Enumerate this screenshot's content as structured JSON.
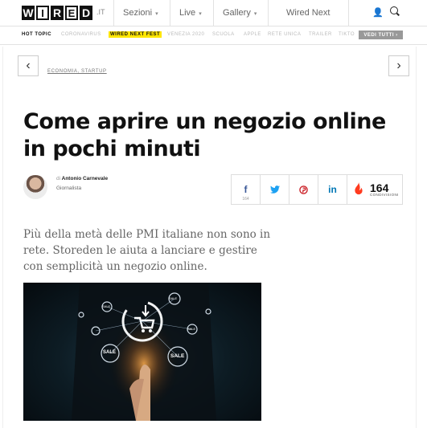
{
  "header": {
    "logo_letters": [
      "W",
      "I",
      "R",
      "E",
      "D"
    ],
    "logo_tld": ".IT",
    "nav": [
      "Sezioni",
      "Live",
      "Gallery",
      "Wired Next"
    ]
  },
  "hotbar": {
    "items": [
      "HOT TOPIC",
      "CORONAVIRUS",
      "WIRED NEXT FEST",
      "VENEZIA 2020",
      "SCUOLA",
      "APPLE",
      "RETE UNICA",
      "TRAILER",
      "TIKTO"
    ],
    "highlight_index": 2,
    "vedi_tutti": "VEDI TUTTI"
  },
  "nav_arrows": {
    "prev": "‹",
    "next": "›"
  },
  "article": {
    "categories": "ECONOMIA, STARTUP",
    "title": "Come aprire un negozio online in pochi minuti",
    "author_prefix": "di",
    "author": "Antonio Carnevale",
    "role": "Giornalista",
    "lead": "Più della metà delle PMI italiane non sono in rete. Storeden le aiuta a lanciare e gestire con semplicità un negozio online."
  },
  "social": {
    "facebook": {
      "glyph": "f",
      "count": "164",
      "color": "#3b5998"
    },
    "twitter": {
      "glyph": "🐦",
      "color": "#1da1f2"
    },
    "pinterest": {
      "glyph": "℗",
      "color": "#cb2027"
    },
    "linkedin": {
      "glyph": "in",
      "color": "#0077b5"
    },
    "shares_count": "164",
    "shares_label": "CONDIVISIONI",
    "flame_color": "#ff3b1f"
  },
  "hero_image": {
    "sale_labels": [
      "SALE",
      "SALE",
      "SALE",
      "SALE",
      "SALE"
    ]
  }
}
